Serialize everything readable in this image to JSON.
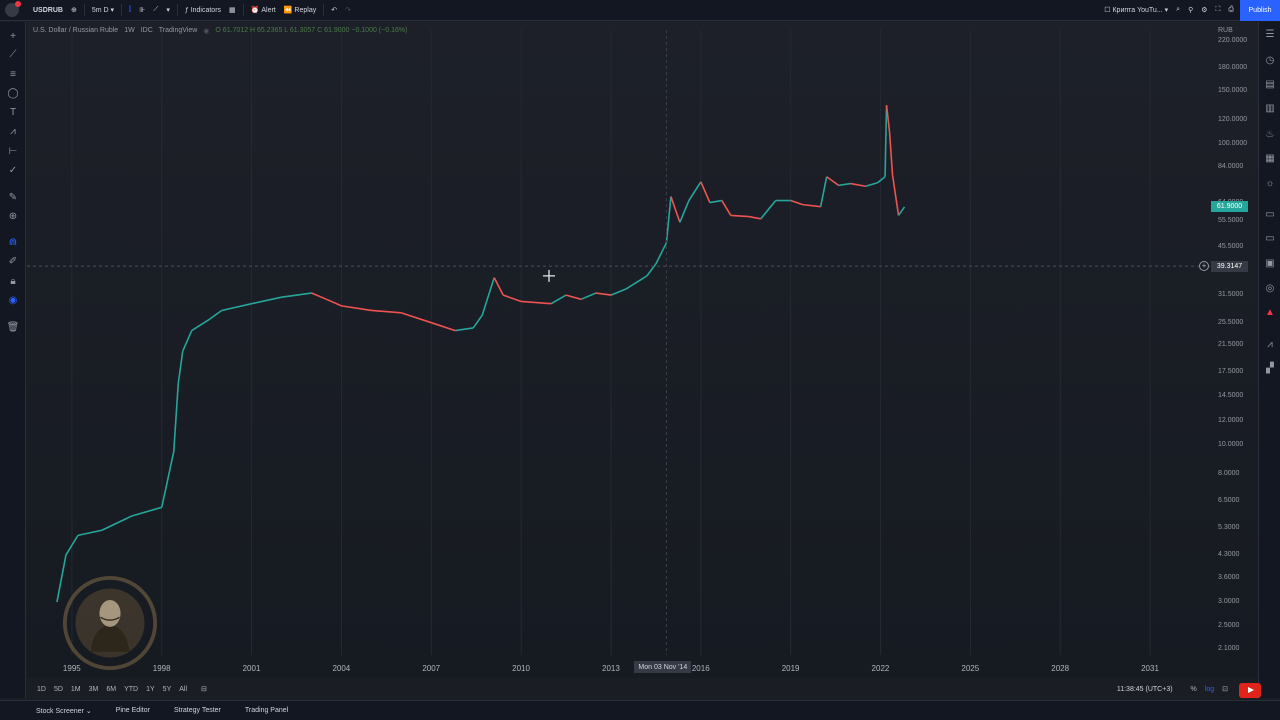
{
  "toolbar": {
    "symbol": "USDRUB",
    "interval": "5m",
    "interval_b": "D",
    "indicators_label": "Indicators",
    "alert_label": "Alert",
    "replay_label": "Replay",
    "layout_name": "Крипта YouTu...",
    "publish_label": "Publish"
  },
  "legend": {
    "title": "U.S. Dollar / Russian Ruble",
    "timeframe": "1W",
    "exchange": "IDC",
    "source": "TradingView",
    "ohlc": "O 61.7012 H 65.2365 L 61.3057 C 61.9000 −0.1000 (−0.16%)"
  },
  "price_axis": {
    "currency": "RUB",
    "labels": [
      "220.0000",
      "180.0000",
      "150.0000",
      "120.0000",
      "100.0000",
      "84.0000",
      "64.0000",
      "55.5000",
      "45.5000",
      "31.5000",
      "25.5000",
      "21.5000",
      "17.5000",
      "14.5000",
      "12.0000",
      "10.0000",
      "8.0000",
      "6.5000",
      "5.3000",
      "4.3000",
      "3.6000",
      "3.0000",
      "2.5000",
      "2.1000"
    ],
    "last_price": "61.9000",
    "crosshair_price": "39.3147"
  },
  "time_axis": {
    "labels": [
      "1995",
      "1998",
      "2001",
      "2004",
      "2007",
      "2010",
      "2013",
      "2016",
      "2019",
      "2022",
      "2025",
      "2028",
      "2031"
    ],
    "crosshair_date": "Mon 03 Nov '14"
  },
  "range_buttons": [
    "1D",
    "5D",
    "1M",
    "3M",
    "6M",
    "YTD",
    "1Y",
    "5Y",
    "All"
  ],
  "status": {
    "clock": "11:38:45 (UTC+3)",
    "percent_label": "%",
    "log_label": "log"
  },
  "bottom_panel": [
    "Stock Screener",
    "Pine Editor",
    "Strategy Tester",
    "Trading Panel"
  ],
  "colors": {
    "up": "#26a69a",
    "down": "#ef5350",
    "accent": "#2962ff",
    "last_price_bg": "#26a69a"
  },
  "chart_data": {
    "type": "line",
    "title": "U.S. Dollar / Russian Ruble",
    "scale": "log",
    "ylim": [
      2.0,
      240
    ],
    "xlim": [
      1993.5,
      2033
    ],
    "series": [
      {
        "name": "USDRUB",
        "x": [
          1994.5,
          1994.8,
          1995.2,
          1996,
          1997,
          1998.0,
          1998.4,
          1998.55,
          1998.7,
          1999.0,
          1999.6,
          2000,
          2001,
          2002,
          2003,
          2003.5,
          2004,
          2005,
          2006,
          2007,
          2007.8,
          2008.4,
          2008.7,
          2009.1,
          2009.4,
          2010,
          2011,
          2011.5,
          2012,
          2012.5,
          2013,
          2013.5,
          2014.2,
          2014.5,
          2014.85,
          2015.0,
          2015.3,
          2015.6,
          2016.0,
          2016.3,
          2016.7,
          2017,
          2017.6,
          2018,
          2018.5,
          2019,
          2019.4,
          2020,
          2020.2,
          2020.6,
          2021,
          2021.5,
          2021.9,
          2022.15,
          2022.2,
          2022.3,
          2022.4,
          2022.6,
          2022.8
        ],
        "y": [
          3.0,
          4.3,
          5.0,
          5.2,
          5.8,
          6.2,
          9.5,
          16.0,
          20.5,
          24.0,
          26.2,
          28.0,
          29.5,
          31.0,
          32.0,
          30.5,
          29.0,
          28.0,
          27.5,
          25.5,
          24.0,
          24.5,
          27.0,
          36.0,
          31.5,
          30.0,
          29.5,
          31.5,
          30.5,
          32.0,
          31.5,
          33.0,
          36.5,
          40.0,
          47.0,
          67.0,
          55.0,
          65.0,
          75.0,
          64.0,
          65.0,
          58.0,
          57.5,
          56.5,
          65.0,
          65.0,
          63.0,
          62.0,
          78.0,
          73.0,
          74.0,
          72.5,
          74.5,
          78.0,
          135.0,
          110.0,
          79.0,
          58.0,
          61.9
        ]
      }
    ]
  }
}
